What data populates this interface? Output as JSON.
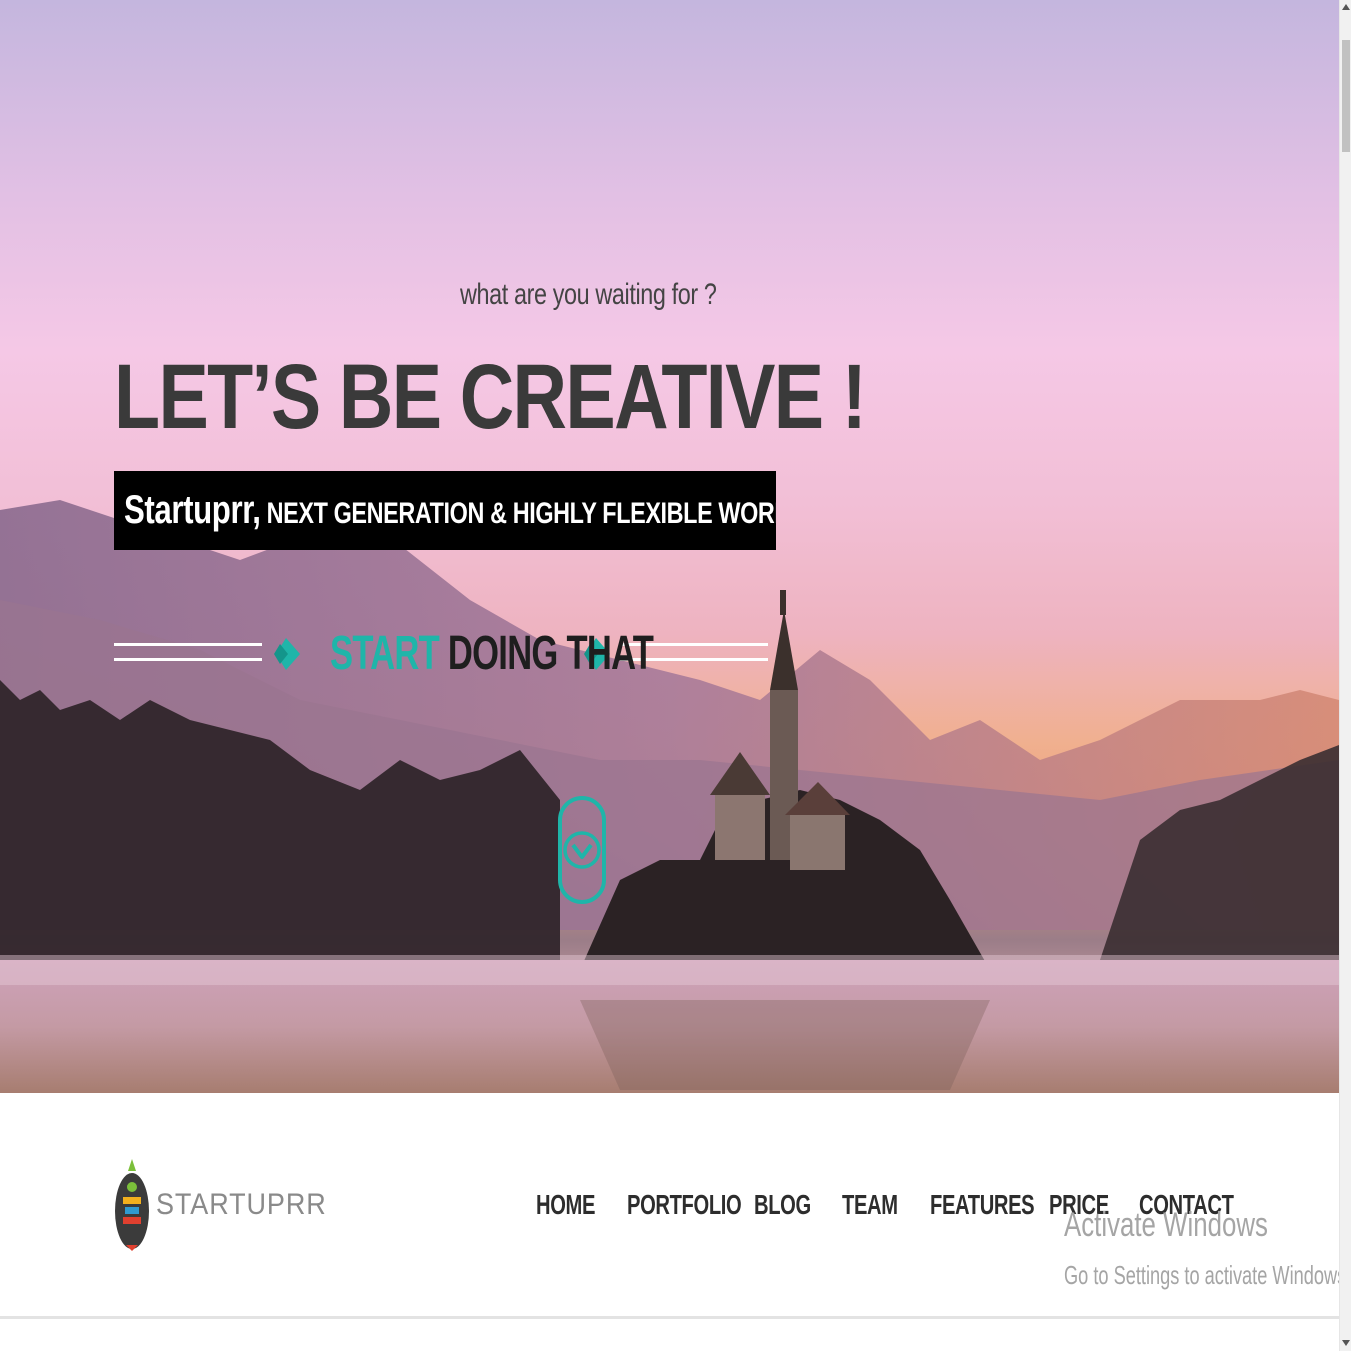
{
  "hero": {
    "tagline": "what are you waiting for ?",
    "headline": "LET’S BE CREATIVE !",
    "subtitle_brand": "Startuprr,",
    "subtitle_rest": " NEXT GENERATION & HIGHLY FLEXIBLE WORDPRESS THEME",
    "cta_accent": "START",
    "cta_rest": " DOING THAT",
    "accent_color": "#1fb5a9",
    "scroll_icon": "chevron-down-icon"
  },
  "nav": {
    "logo_text": "STARTUPRR",
    "items": [
      "HOME",
      "PORTFOLIO",
      "BLOG",
      "TEAM",
      "FEATURES",
      "PRICE",
      "CONTACT"
    ]
  },
  "watermark": {
    "title": "Activate Windows",
    "subtitle": "Go to Settings to activate Windows."
  }
}
